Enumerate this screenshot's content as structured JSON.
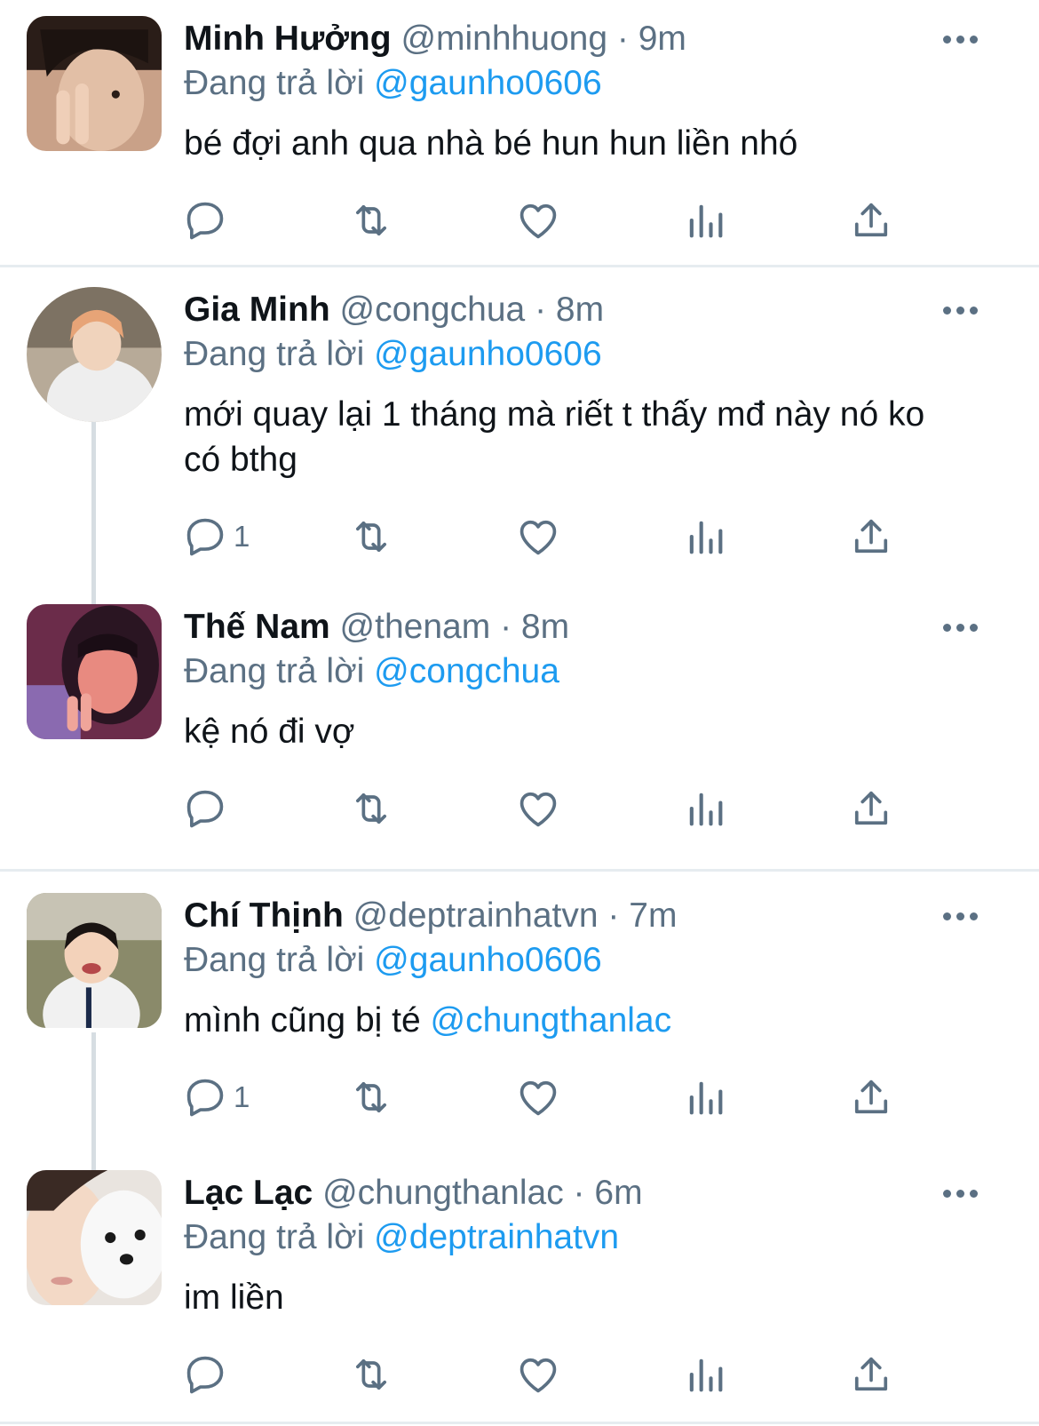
{
  "colors": {
    "accent": "#1d9bf0",
    "meta": "#5b7083",
    "text": "#0f1419",
    "divider": "#e6ecf0",
    "thread": "#d6dde2"
  },
  "tweets": [
    {
      "name": "Minh Hưởng",
      "handle": "@minhhuong",
      "time": "9m",
      "reply_prefix": "Đang trả lời ",
      "reply_to": "@gaunho0606",
      "text": "bé đợi anh qua nhà bé hun hun liền nhó",
      "mention": "",
      "reply_count": ""
    },
    {
      "name": "Gia Minh",
      "handle": "@congchua",
      "time": "8m",
      "reply_prefix": "Đang trả lời ",
      "reply_to": "@gaunho0606",
      "text": "mới quay lại 1 tháng mà riết t thấy mđ này nó ko có bthg",
      "mention": "",
      "reply_count": "1"
    },
    {
      "name": "Thế Nam",
      "handle": "@thenam",
      "time": "8m",
      "reply_prefix": "Đang trả lời ",
      "reply_to": "@congchua",
      "text": "kệ nó đi vợ",
      "mention": "",
      "reply_count": ""
    },
    {
      "name": "Chí Thịnh",
      "handle": "@deptrainhatvn",
      "time": "7m",
      "reply_prefix": "Đang trả lời ",
      "reply_to": "@gaunho0606",
      "text": "mình cũng bị té ",
      "mention": "@chungthanlac",
      "reply_count": "1"
    },
    {
      "name": "Lạc Lạc",
      "handle": "@chungthanlac",
      "time": "6m",
      "reply_prefix": "Đang trả lời ",
      "reply_to": "@deptrainhatvn",
      "text": "im liền",
      "mention": "",
      "reply_count": ""
    }
  ],
  "separator": " · ",
  "icons": [
    "reply-icon",
    "retweet-icon",
    "like-icon",
    "analytics-icon",
    "share-icon",
    "more-icon"
  ]
}
